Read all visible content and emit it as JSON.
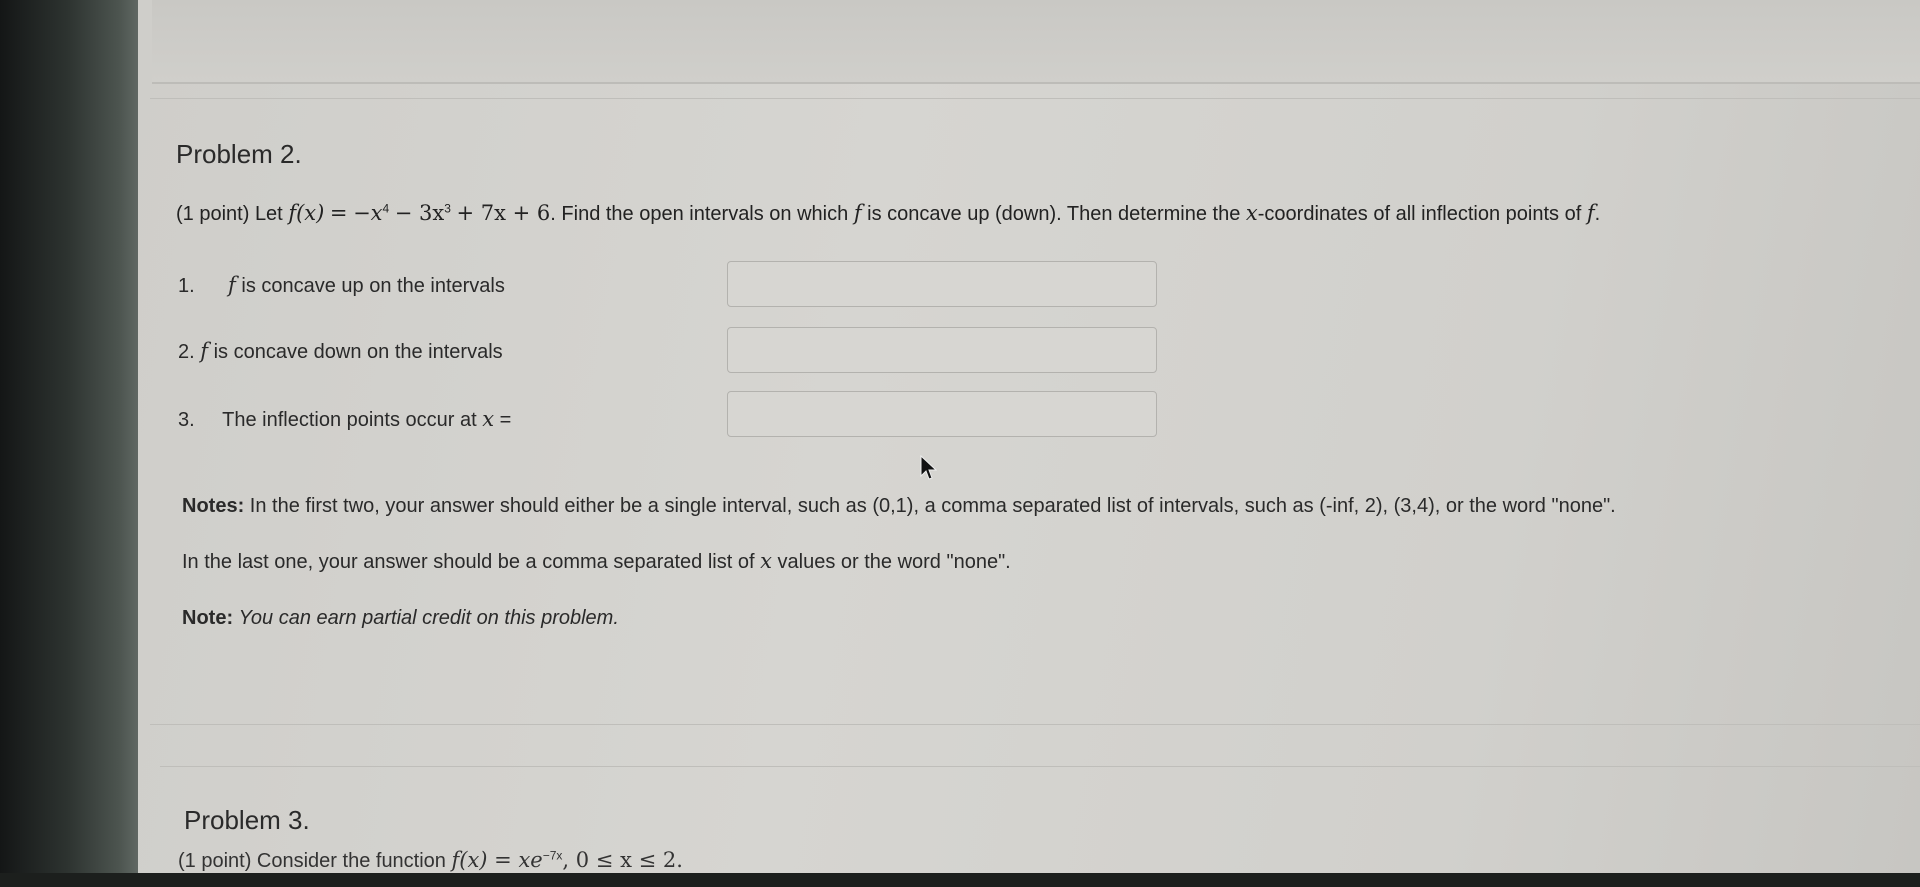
{
  "problem2": {
    "title": "Problem 2.",
    "points": "(1 point)",
    "let": "Let",
    "function_lhs": "f(x)",
    "equals": "=",
    "term1": "−x",
    "exp4": "4",
    "term2": "− 3x",
    "exp3": "3",
    "term3": "+ 7x + 6",
    "instruction_a": ". Find the open intervals on which",
    "f": "f",
    "instruction_b": "is concave up (down). Then determine the",
    "x": "x",
    "instruction_c": "-coordinates of all inflection points of",
    "period": ".",
    "parts": [
      {
        "number": "1.",
        "var": "f",
        "label": "is concave up on the intervals",
        "value": ""
      },
      {
        "number": "2.",
        "var": "f",
        "label": "is concave down on the intervals",
        "value": ""
      },
      {
        "number": "3.",
        "label": "The inflection points occur at",
        "var": "x",
        "eq": "=",
        "value": ""
      }
    ],
    "notes_label": "Notes:",
    "notes_text": "In the first two, your answer should either be a single interval, such as (0,1), a comma separated list of intervals, such as (-inf, 2), (3,4), or the word \"none\".",
    "last_a": "In the last one, your answer should be a comma separated list of",
    "last_x": "x",
    "last_b": "values or the word \"none\".",
    "note_label": "Note:",
    "note_text": "You can earn partial credit on this problem."
  },
  "problem3": {
    "title": "Problem 3.",
    "partial_a": "(1 point) Consider the function",
    "partial_f": "f(x) = xe",
    "partial_exp": "−7x",
    "partial_b": ",   0 ≤ x ≤ 2."
  }
}
